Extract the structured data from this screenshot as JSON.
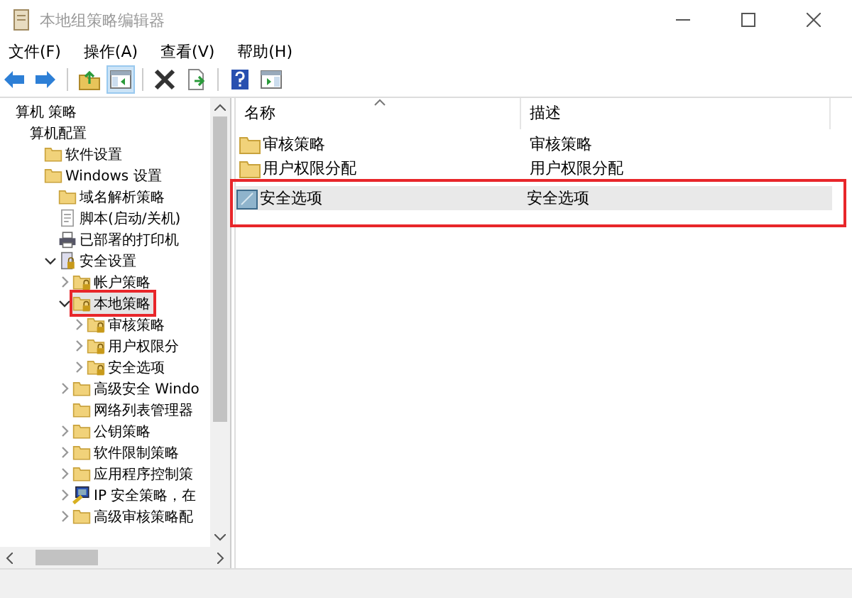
{
  "window": {
    "title": "本地组策略编辑器"
  },
  "menu": [
    "文件(F)",
    "操作(A)",
    "查看(V)",
    "帮助(H)"
  ],
  "toolbar": [
    {
      "kind": "back",
      "pressed": false
    },
    {
      "kind": "forward",
      "pressed": false
    },
    {
      "kind": "sep"
    },
    {
      "kind": "up",
      "pressed": false
    },
    {
      "kind": "tree",
      "pressed": true
    },
    {
      "kind": "sep"
    },
    {
      "kind": "delete",
      "pressed": false
    },
    {
      "kind": "export",
      "pressed": false
    },
    {
      "kind": "sep"
    },
    {
      "kind": "help",
      "pressed": false
    },
    {
      "kind": "pane",
      "pressed": false
    }
  ],
  "tree": [
    {
      "label": "算机 策略",
      "selected": false,
      "outlined": false,
      "children": [
        {
          "label": "算机配置",
          "selected": false,
          "outlined": false,
          "children": [
            {
              "label": "软件设置",
              "kind": "folder",
              "selected": false,
              "outlined": false
            },
            {
              "label": "Windows 设置",
              "kind": "folder",
              "selected": false,
              "outlined": false,
              "children": [
                {
                  "label": "域名解析策略",
                  "kind": "folder",
                  "selected": false,
                  "outlined": false
                },
                {
                  "label": "脚本(启动/关机)",
                  "kind": "script",
                  "selected": false,
                  "outlined": false
                },
                {
                  "label": "已部署的打印机",
                  "kind": "printer",
                  "selected": false,
                  "outlined": false
                },
                {
                  "label": "安全设置",
                  "kind": "security",
                  "selected": false,
                  "outlined": false,
                  "expanded": true,
                  "children": [
                    {
                      "label": "帐户策略",
                      "kind": "lockfolder",
                      "selected": false,
                      "outlined": false,
                      "expanded": false
                    },
                    {
                      "label": "本地策略",
                      "kind": "lockfolder",
                      "selected": true,
                      "outlined": true,
                      "expanded": true,
                      "children": [
                        {
                          "label": "审核策略",
                          "kind": "lockfolder",
                          "selected": false,
                          "outlined": false,
                          "expanded": false
                        },
                        {
                          "label": "用户权限分",
                          "kind": "lockfolder",
                          "selected": false,
                          "outlined": false,
                          "expanded": false
                        },
                        {
                          "label": "安全选项",
                          "kind": "lockfolder",
                          "selected": false,
                          "outlined": false,
                          "expanded": false
                        }
                      ]
                    },
                    {
                      "label": "高级安全 Windo",
                      "kind": "folder",
                      "selected": false,
                      "outlined": false,
                      "expanded": false
                    },
                    {
                      "label": "网络列表管理器",
                      "kind": "folder",
                      "selected": false,
                      "outlined": false
                    },
                    {
                      "label": "公钥策略",
                      "kind": "folder",
                      "selected": false,
                      "outlined": false,
                      "expanded": false
                    },
                    {
                      "label": "软件限制策略",
                      "kind": "folder",
                      "selected": false,
                      "outlined": false,
                      "expanded": false
                    },
                    {
                      "label": "应用程序控制策",
                      "kind": "folder",
                      "selected": false,
                      "outlined": false,
                      "expanded": false
                    },
                    {
                      "label": "IP 安全策略，在",
                      "kind": "ip",
                      "selected": false,
                      "outlined": false,
                      "expanded": false
                    },
                    {
                      "label": "高级审核策略配",
                      "kind": "folder",
                      "selected": false,
                      "outlined": false,
                      "expanded": false
                    }
                  ]
                }
              ]
            }
          ]
        }
      ]
    }
  ],
  "list": {
    "columns": [
      "名称",
      "描述"
    ],
    "rows": [
      {
        "name": "审核策略",
        "description": "审核策略",
        "kind": "folder",
        "selected": false,
        "outlined": false
      },
      {
        "name": "用户权限分配",
        "description": "用户权限分配",
        "kind": "folder",
        "selected": false,
        "outlined": false
      },
      {
        "name": "安全选项",
        "description": "安全选项",
        "kind": "policy",
        "selected": true,
        "outlined": true
      }
    ]
  }
}
